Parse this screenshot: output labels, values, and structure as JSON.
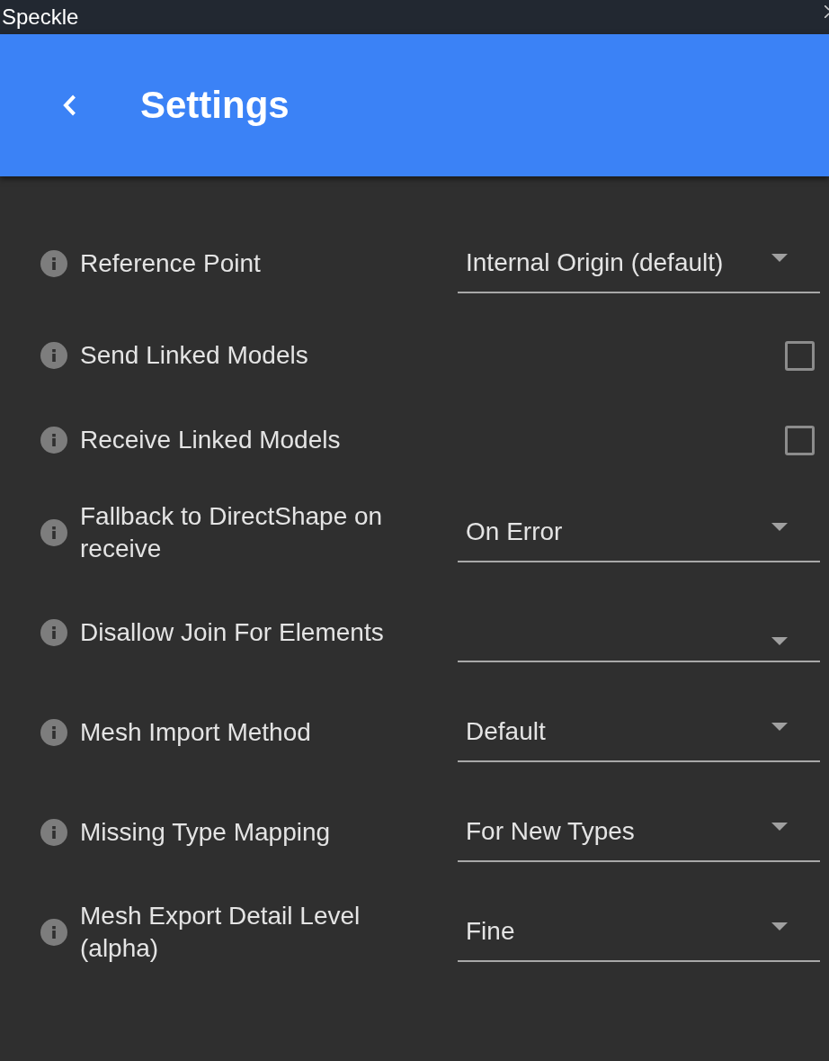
{
  "window": {
    "title": "Speckle"
  },
  "header": {
    "title": "Settings"
  },
  "settings": [
    {
      "kind": "select",
      "label": "Reference Point",
      "value": "Internal Origin (default)"
    },
    {
      "kind": "checkbox",
      "label": "Send Linked Models",
      "checked": false
    },
    {
      "kind": "checkbox",
      "label": "Receive Linked Models",
      "checked": false
    },
    {
      "kind": "select",
      "label": "Fallback to DirectShape on receive",
      "value": "On Error"
    },
    {
      "kind": "select",
      "label": "Disallow Join For Elements"
    },
    {
      "kind": "select",
      "label": "Mesh Import Method",
      "value": "Default"
    },
    {
      "kind": "select",
      "label": "Missing Type Mapping",
      "value": "For New Types"
    },
    {
      "kind": "select",
      "label": "Mesh Export Detail Level (alpha)",
      "value": "Fine"
    }
  ]
}
